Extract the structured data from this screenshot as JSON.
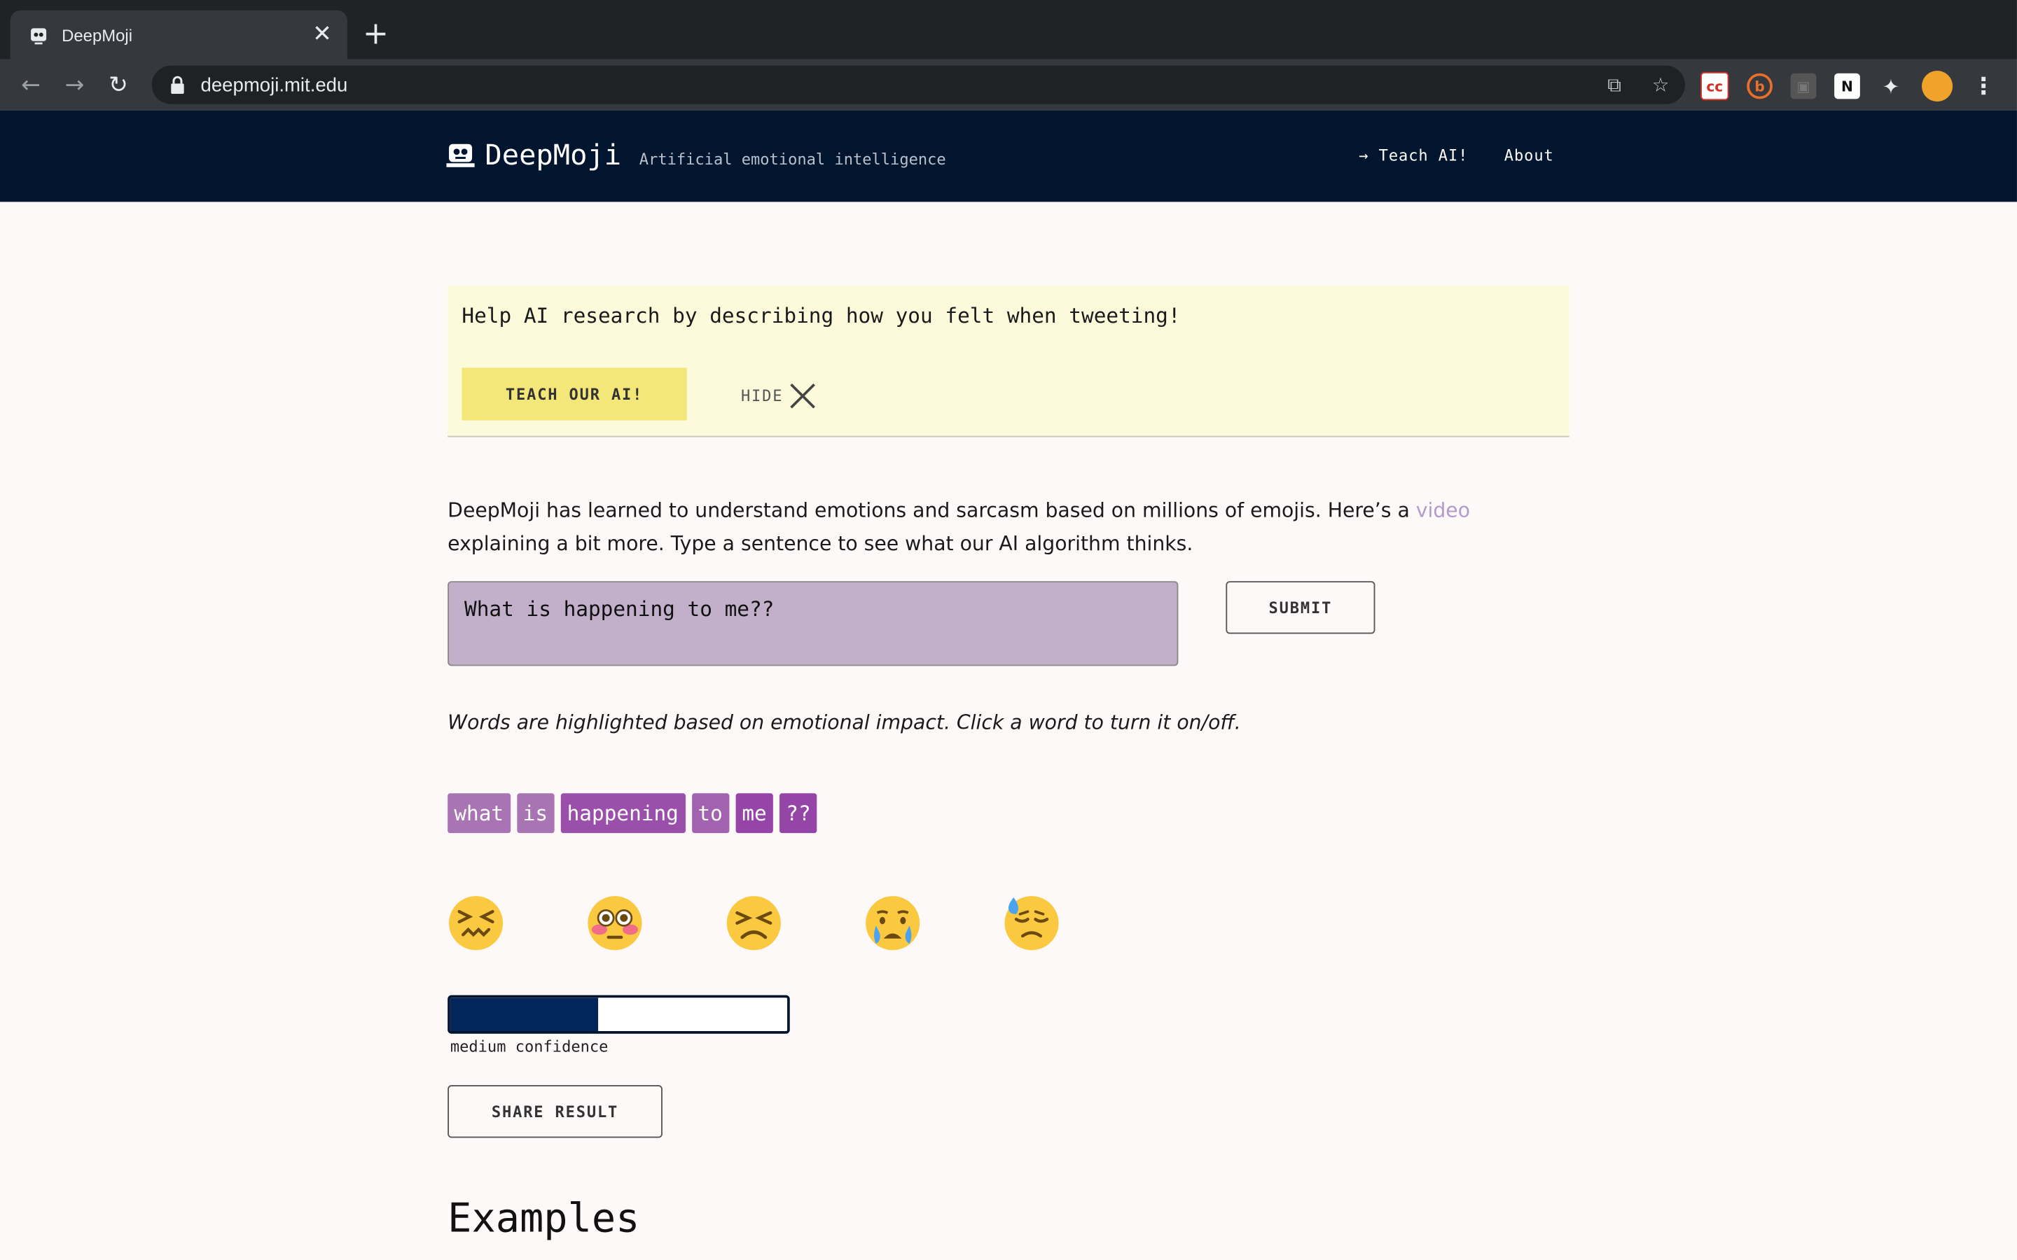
{
  "browser": {
    "tab_title": "DeepMoji",
    "url": "deepmoji.mit.edu",
    "new_tab_label": "+",
    "tab_close_label": "✕"
  },
  "site": {
    "name": "DeepMoji",
    "tagline": "Artificial emotional intelligence",
    "nav": [
      {
        "label": "→ Teach AI!"
      },
      {
        "label": "About"
      }
    ]
  },
  "banner": {
    "message": "Help AI research by describing how you felt when tweeting!",
    "teach_button": "TEACH OUR AI!",
    "hide_label": "HIDE"
  },
  "intro": {
    "text_before": "DeepMoji has learned to understand emotions and sarcasm based on millions of emojis. Here’s a ",
    "link_text": "video",
    "text_after": " explaining a bit more. Type a sentence to see what our AI algorithm thinks."
  },
  "input": {
    "value": "What is happening to me??",
    "submit_label": "SUBMIT"
  },
  "hint": "Words are highlighted based on emotional impact. Click a word to turn it on/off.",
  "words": [
    {
      "text": "what",
      "color": "#a974b3"
    },
    {
      "text": "is",
      "color": "#a974b3"
    },
    {
      "text": "happening",
      "color": "#9a4fab"
    },
    {
      "text": "to",
      "color": "#a262b0"
    },
    {
      "text": "me",
      "color": "#9545a8"
    },
    {
      "text": "??",
      "color": "#9545a8"
    }
  ],
  "emojis": [
    {
      "name": "confounded-face"
    },
    {
      "name": "flushed-face"
    },
    {
      "name": "persevering-face"
    },
    {
      "name": "crying-face"
    },
    {
      "name": "downcast-face-with-sweat"
    }
  ],
  "confidence": {
    "level": 0.44,
    "label": "medium confidence"
  },
  "share_label": "SHARE RESULT",
  "examples_heading": "Examples",
  "colors": {
    "header_bg": "#02152e",
    "banner_bg": "#fdfadc",
    "teach_btn": "#f4e77a",
    "input_bg": "#c2afc9",
    "link": "#b39bc9"
  }
}
